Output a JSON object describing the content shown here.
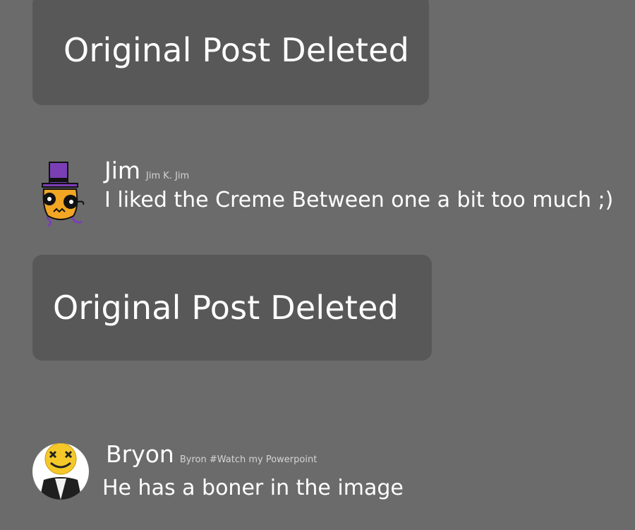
{
  "posts": [
    {
      "deleted_label": "Original Post Deleted"
    },
    {
      "deleted_label": "Original Post Deleted"
    }
  ],
  "comments": [
    {
      "name": "Jim",
      "handle": "Jim K. Jim",
      "text": "I liked the Creme Between one a bit too much ;)",
      "avatar_icon": "top-hat-monster-icon"
    },
    {
      "name": "Bryon",
      "handle": "Byron #Watch my Powerpoint",
      "text": "He has a boner in the image",
      "avatar_icon": "dizzy-face-person-icon"
    }
  ],
  "colors": {
    "background": "#6b6b6b",
    "card": "#585858",
    "text": "#ffffff",
    "handle": "#d4d4d4",
    "hat_purple": "#7a3fb5",
    "monster_orange": "#f2a623"
  }
}
